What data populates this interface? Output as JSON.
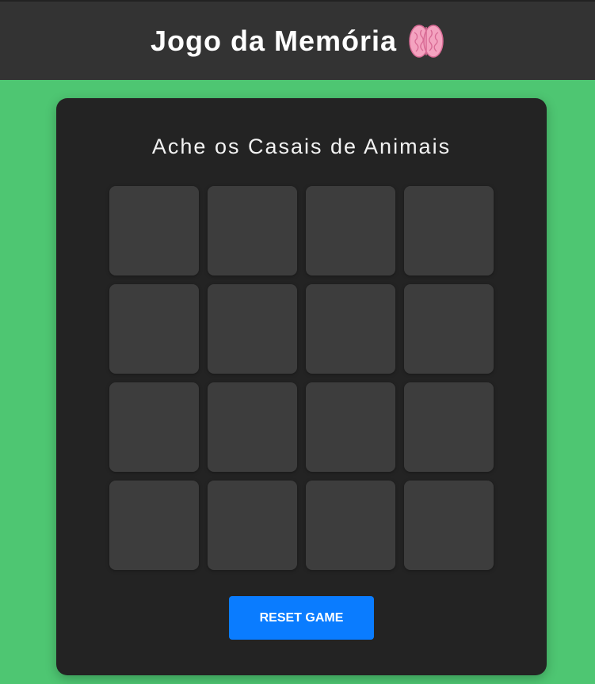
{
  "header": {
    "title": "Jogo da Memória",
    "icon": "brain-icon"
  },
  "game": {
    "subtitle": "Ache os Casais de Animais",
    "tile_count": 16,
    "tile_color": "#3d3d3d",
    "reset_label": "RESET GAME"
  },
  "colors": {
    "background": "#4ec672",
    "header": "#333333",
    "panel": "#232323",
    "button": "#0a7cff"
  }
}
